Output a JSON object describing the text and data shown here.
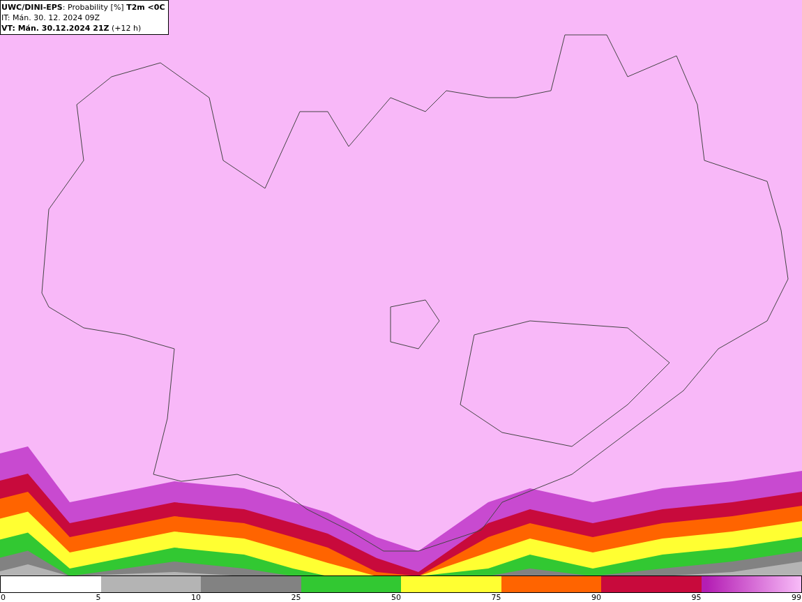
{
  "title_box": {
    "lines": [
      "**UWC/DINI-EPS**: Probability [%] **T2m <0C**",
      "IT: Mán. 30. 12. 2024 09Z",
      "**VT: Mán. 30.12.2024 21Z** (+12 h)"
    ]
  },
  "legend": {
    "segments": [
      {
        "color": "#ffffff"
      },
      {
        "color": "#b4b4b4"
      },
      {
        "color": "#828282"
      },
      {
        "color": "#32c832"
      },
      {
        "color": "#ffff32"
      },
      {
        "color": "#ff6400"
      },
      {
        "color": "#c80a3c"
      },
      {
        "color": "#b41eb4",
        "kind": "gradient"
      }
    ],
    "labels": [
      "0",
      "5",
      "10",
      "25",
      "50",
      "75",
      "90",
      "95",
      "99"
    ]
  }
}
